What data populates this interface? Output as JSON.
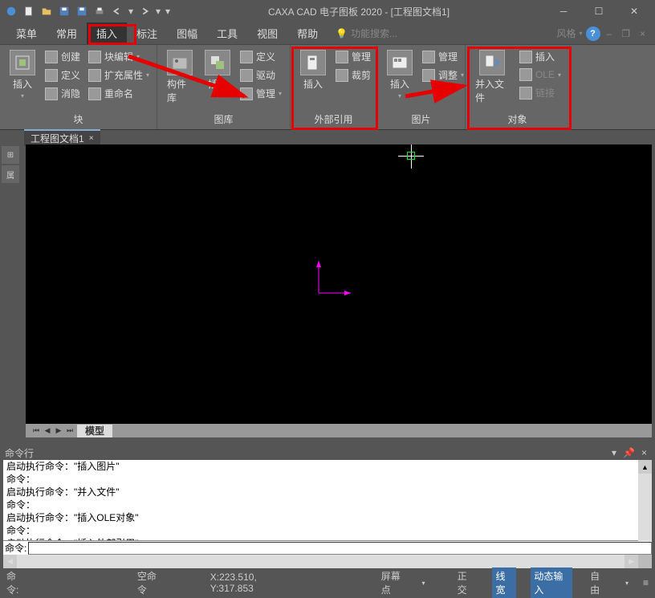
{
  "app_title": "CAXA CAD 电子图板 2020 - [工程图文档1]",
  "menubar": {
    "items": [
      "菜单",
      "常用",
      "插入",
      "标注",
      "图幅",
      "工具",
      "视图",
      "帮助"
    ],
    "active_index": 2,
    "search_placeholder": "功能搜索...",
    "style_label": "风格"
  },
  "ribbon": {
    "panels": [
      {
        "label": "块",
        "big": {
          "label": "插入"
        },
        "rows": [
          {
            "label": "创建"
          },
          {
            "label": "定义"
          },
          {
            "label": "消隐"
          },
          {
            "label": "块编辑"
          },
          {
            "label": "扩充属性"
          },
          {
            "label": "重命名"
          }
        ]
      },
      {
        "label": "图库",
        "big": {
          "label": "构件库"
        },
        "big2": {
          "label": "插入"
        },
        "rows": [
          {
            "label": "定义"
          },
          {
            "label": "驱动"
          },
          {
            "label": "管理"
          }
        ]
      },
      {
        "label": "外部引用",
        "big": {
          "label": "插入"
        },
        "rows": [
          {
            "label": "管理"
          },
          {
            "label": "裁剪"
          }
        ]
      },
      {
        "label": "图片",
        "big": {
          "label": "插入"
        },
        "rows": [
          {
            "label": "管理"
          },
          {
            "label": "调整"
          }
        ]
      },
      {
        "label": "对象",
        "big": {
          "label": "并入文件"
        },
        "rows": [
          {
            "label": "插入"
          },
          {
            "label": "OLE"
          },
          {
            "label": "链接"
          }
        ]
      }
    ]
  },
  "doctab": {
    "name": "工程图文档1",
    "close": "×"
  },
  "model_tab": "模型",
  "cmdwin": {
    "title": "命令行",
    "lines": [
      "启动执行命令：\"插入图片\"",
      "命令：",
      "启动执行命令：\"并入文件\"",
      "命令：",
      "启动执行命令：\"插入OLE对象\"",
      "命令：",
      "启动执行命令：\"插入外部引用\""
    ],
    "prompt": "命令:"
  },
  "statusbar": {
    "cmd_label": "命令:",
    "empty_cmd": "空命令",
    "coords": "X:223.510, Y:317.853",
    "screen_pt": "屏幕点",
    "toggles": {
      "ortho": "正交",
      "lwt": "线宽",
      "dyn": "动态输入",
      "free": "自由"
    }
  }
}
